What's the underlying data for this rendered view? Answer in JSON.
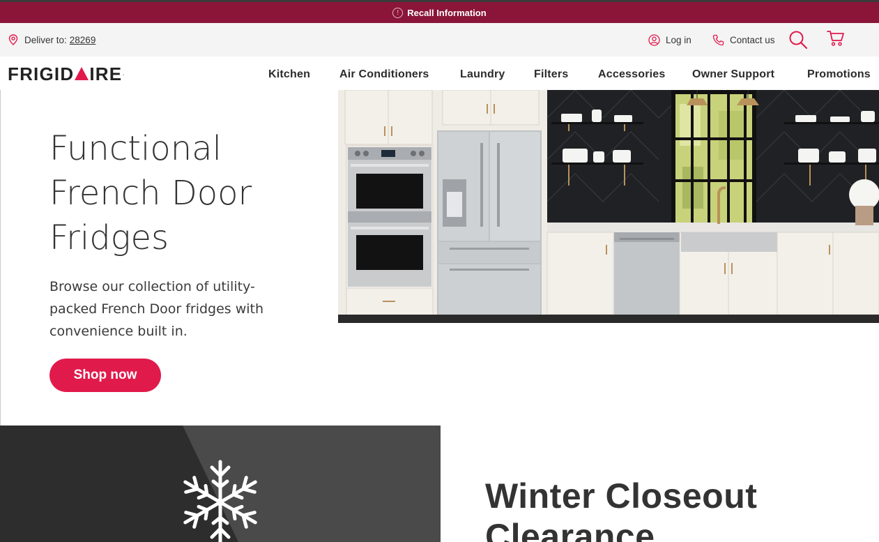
{
  "recall": {
    "label": "Recall Information",
    "icon": "info-icon"
  },
  "utility": {
    "deliver_label": "Deliver to:",
    "zip": "28269",
    "login": "Log in",
    "contact": "Contact us"
  },
  "logo": {
    "text_before": "FRIGID",
    "text_after": "IRE",
    "reg": "."
  },
  "nav": {
    "items": [
      {
        "label": "Kitchen"
      },
      {
        "label": "Air Conditioners"
      },
      {
        "label": "Laundry"
      },
      {
        "label": "Filters"
      },
      {
        "label": "Accessories"
      },
      {
        "label": "Owner Support"
      },
      {
        "label": "Promotions"
      }
    ]
  },
  "hero": {
    "title": "Functional French Door Fridges",
    "description": "Browse our collection of utility-packed French Door fridges with convenience built in.",
    "cta": "Shop now"
  },
  "promo": {
    "title": "Winter Closeout Clearance"
  },
  "colors": {
    "recall_bg": "#8a1538",
    "accent": "#e11a4c",
    "promo_dark": "#2d2d2d"
  }
}
